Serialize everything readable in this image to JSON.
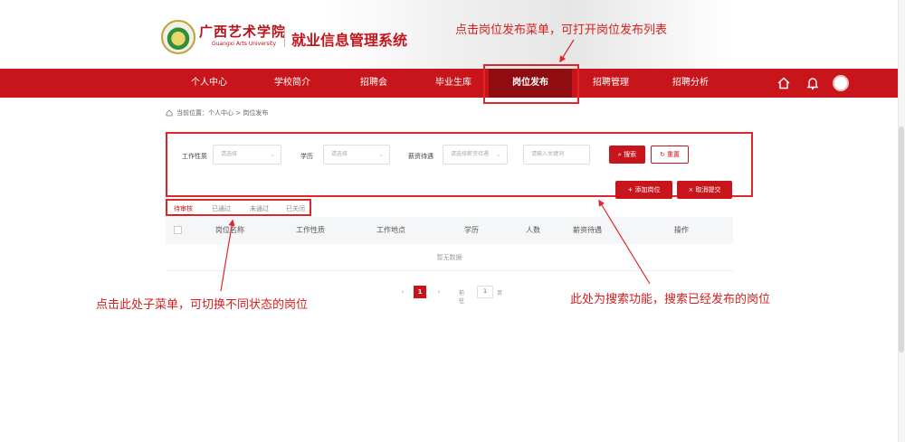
{
  "header": {
    "college_name_cn": "广西艺术学院",
    "college_name_en": "Guangxi Arts University",
    "system_title": "就业信息管理系统"
  },
  "nav": {
    "items": [
      {
        "label": "个人中心"
      },
      {
        "label": "学校简介"
      },
      {
        "label": "招聘会"
      },
      {
        "label": "毕业生库"
      },
      {
        "label": "岗位发布"
      },
      {
        "label": "招聘管理"
      },
      {
        "label": "招聘分析"
      }
    ],
    "active_index": 4,
    "icons": [
      "home-icon",
      "bell-icon",
      "avatar"
    ]
  },
  "breadcrumb": {
    "text": "当前位置：个人中心 > 岗位发布"
  },
  "search": {
    "job_type_label": "工作性质",
    "job_type_placeholder": "请选择",
    "education_label": "学历",
    "education_placeholder": "请选择",
    "salary_label": "薪资待遇",
    "salary_placeholder": "请选择薪资待遇",
    "keyword_placeholder": "请输入关键词",
    "search_button": "搜索",
    "reset_button": "重置",
    "add_button": "+ 添加岗位",
    "cancel_button": "× 取消提交"
  },
  "tabs": {
    "items": [
      "待审核",
      "已通过",
      "未通过",
      "已关闭"
    ],
    "active_index": 0
  },
  "table": {
    "columns": [
      "岗位名称",
      "工作性质",
      "工作地点",
      "学历",
      "人数",
      "薪资待遇",
      "操作"
    ],
    "empty_text": "暂无数据"
  },
  "pagination": {
    "current_page": "1",
    "goto_label": "前往",
    "goto_value": "1",
    "page_suffix": "页"
  },
  "annotations": {
    "top": "点击岗位发布菜单，可打开岗位发布列表",
    "left": "点击此处子菜单，可切换不同状态的岗位",
    "right": "此处为搜索功能，搜索已经发布的岗位"
  },
  "colors": {
    "brand_red": "#c8141b",
    "active_nav": "#8f0d11",
    "annotation_red": "#e0262a"
  }
}
